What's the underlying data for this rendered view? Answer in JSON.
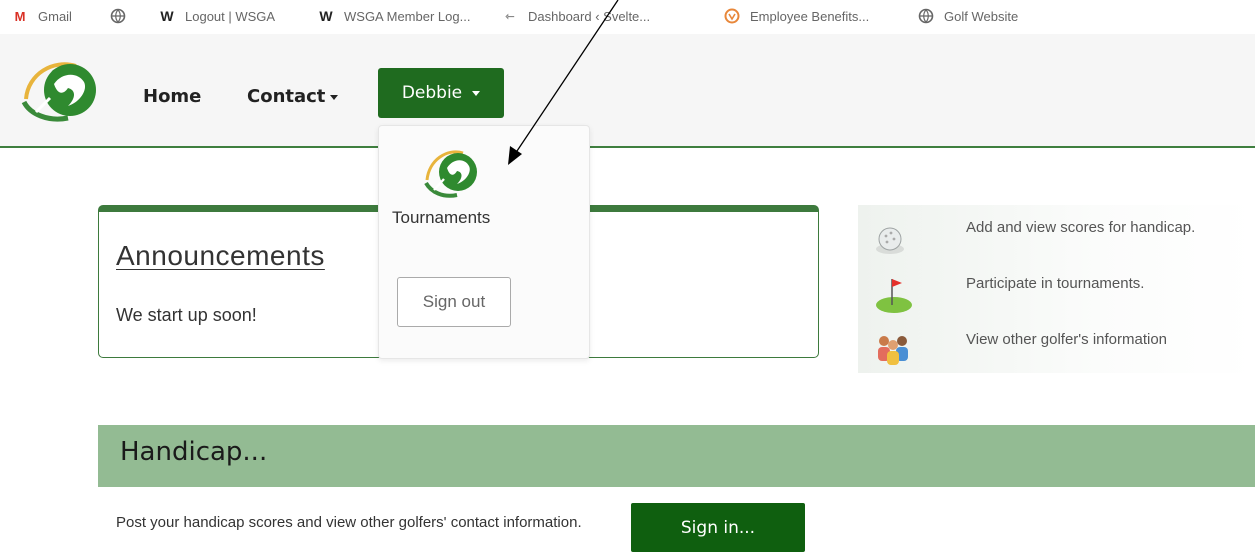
{
  "bookmarks": [
    {
      "label": "Gmail",
      "icon": "gmail-icon"
    },
    {
      "label": "",
      "icon": "globe-icon"
    },
    {
      "label": "Logout | WSGA",
      "icon": "w-icon"
    },
    {
      "label": "WSGA Member Log...",
      "icon": "w-icon"
    },
    {
      "label": "Dashboard ‹ Svelte...",
      "icon": "dashboard-icon"
    },
    {
      "label": "Employee Benefits...",
      "icon": "benefits-icon"
    },
    {
      "label": "Golf Website",
      "icon": "globe-icon"
    }
  ],
  "navbar": {
    "home": "Home",
    "contact": "Contact",
    "user": "Debbie"
  },
  "dropdown": {
    "item": "Tournaments",
    "signout": "Sign out"
  },
  "announcements": {
    "title": "Announcements",
    "text": "We start up soon!"
  },
  "features": [
    {
      "text": "Add and view scores for handicap.",
      "icon": "golf-ball-icon"
    },
    {
      "text": "Participate in tournaments.",
      "icon": "golf-green-icon"
    },
    {
      "text": "View other golfer's information",
      "icon": "people-icon"
    }
  ],
  "handicap": {
    "title": "Handicap...",
    "text": "Post your handicap scores and view other golfers' contact information.",
    "signin": "Sign in..."
  },
  "colors": {
    "brand_green": "#1f6b1f",
    "band_green": "#93bb93",
    "border_green": "#3d7a3d"
  }
}
